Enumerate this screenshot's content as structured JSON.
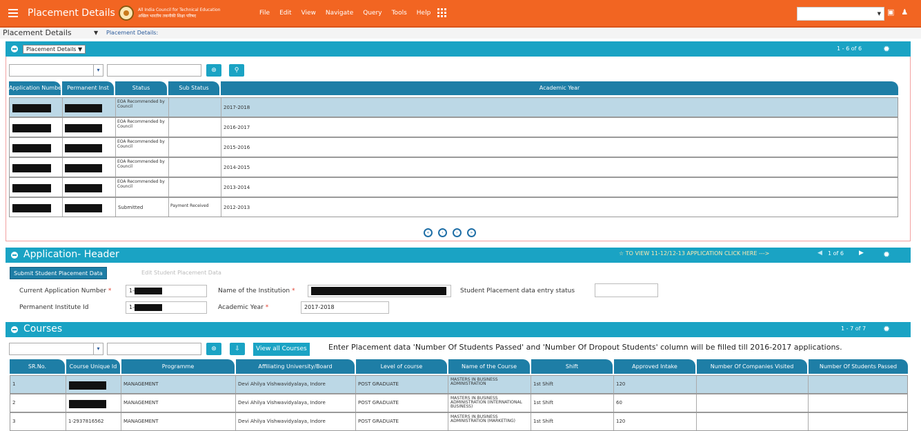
{
  "header": {
    "title": "Placement Details",
    "org_line1": "All India Council for Technical Education",
    "org_line2": "अखिल भारतीय तकनीकी शिक्षा परिषद",
    "menus": [
      "File",
      "Edit",
      "View",
      "Navigate",
      "Query",
      "Tools",
      "Help"
    ]
  },
  "breadcrumb": {
    "current": "Placement Details",
    "link": "Placement Details:"
  },
  "placement_panel": {
    "dropdown": "Placement Details",
    "count": "1 - 6 of 6",
    "columns": [
      "Application Number",
      "Permanent Inst",
      "Status",
      "Sub Status",
      "Academic Year"
    ],
    "rows": [
      {
        "status": "EOA Recommended by Council",
        "sub_status": "",
        "year": "2017-2018"
      },
      {
        "status": "EOA Recommended by Council",
        "sub_status": "",
        "year": "2016-2017"
      },
      {
        "status": "EOA Recommended by Council",
        "sub_status": "",
        "year": "2015-2016"
      },
      {
        "status": "EOA Recommended by Council",
        "sub_status": "",
        "year": "2014-2015"
      },
      {
        "status": "EOA Recommended by Council",
        "sub_status": "",
        "year": "2013-2014"
      },
      {
        "status": "Submitted",
        "sub_status": "Payment Received",
        "year": "2012-2013"
      }
    ]
  },
  "app_header": {
    "title": "Application- Header",
    "link": "TO VIEW 11-12/12-13 APPLICATION CLICK HERE --->",
    "count": "1 of 6",
    "submit_btn": "Submit Student Placement Data",
    "edit_btn": "Edit Student Placement Data",
    "lbl_app_no": "Current Application Number",
    "val_app_no": "1-",
    "lbl_inst_name": "Name of the Institution",
    "lbl_entry_status": "Student Placement data entry status",
    "lbl_perm_id": "Permanent Institute Id",
    "val_perm_id": "1-",
    "lbl_year": "Academic Year",
    "val_year": "2017-2018"
  },
  "courses": {
    "title": "Courses",
    "count": "1 - 7 of 7",
    "view_all": "View all Courses",
    "notice": "Enter Placement data 'Number Of Students Passed' and 'Number Of Dropout Students' column will be filled till 2016-2017 applications.",
    "columns": [
      "SR.No.",
      "Course Unique Id",
      "Programme",
      "Affiliating University/Board",
      "Level of course",
      "Name of the Course",
      "Shift",
      "Approved Intake",
      "Number Of Companies Visited",
      "Number Of Students Passed"
    ],
    "rows": [
      {
        "sr": "1",
        "uid": "",
        "prog": "MANAGEMENT",
        "univ": "Devi Ahilya Vishwavidyalaya, Indore",
        "level": "POST GRADUATE",
        "name": "MASTERS IN BUSINESS ADMINISTRATION",
        "shift": "1st Shift",
        "intake": "120"
      },
      {
        "sr": "2",
        "uid": "",
        "prog": "MANAGEMENT",
        "univ": "Devi Ahilya Vishwavidyalaya, Indore",
        "level": "POST GRADUATE",
        "name": "MASTERS IN BUSINESS ADMINISTRATION (INTERNATIONAL BUSINESS)",
        "shift": "1st Shift",
        "intake": "60"
      },
      {
        "sr": "3",
        "uid": "1-2937816562",
        "prog": "MANAGEMENT",
        "univ": "Devi Ahilya Vishwavidyalaya, Indore",
        "level": "POST GRADUATE",
        "name": "MASTERS IN BUSINESS ADMINISTRATION (MARKETING)",
        "shift": "1st Shift",
        "intake": "120"
      }
    ]
  }
}
